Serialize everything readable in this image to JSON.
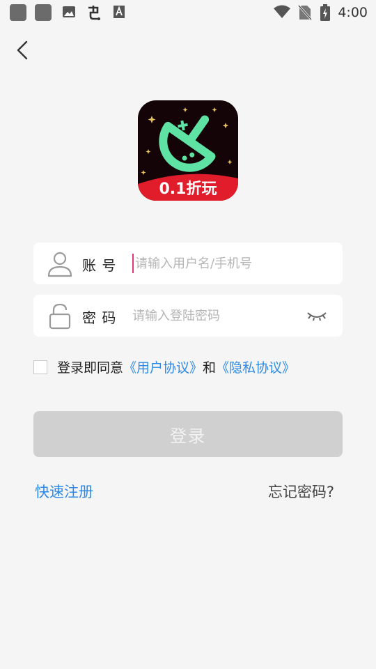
{
  "status_bar": {
    "time": "4:00",
    "icons": [
      "app-icon",
      "app-icon",
      "image-icon",
      "game-icon",
      "font-icon",
      "wifi-icon",
      "no-sim-icon",
      "battery-charging-icon"
    ]
  },
  "header": {
    "back_icon": "back-arrow-icon"
  },
  "logo": {
    "text": "0.1折玩"
  },
  "account": {
    "label": "账 号",
    "placeholder": "请输入用户名/手机号",
    "icon": "user-icon"
  },
  "password": {
    "label": "密 码",
    "placeholder": "请输入登陆密码",
    "icon": "lock-icon",
    "toggle_icon": "eye-closed-icon"
  },
  "agreement": {
    "checked": false,
    "prefix": "登录即同意",
    "user_link": "《用户协议》",
    "conjunction": "和",
    "privacy_link": "《隐私协议》"
  },
  "login": {
    "label": "登录"
  },
  "links": {
    "register": "快速注册",
    "forgot": "忘记密码?"
  },
  "colors": {
    "accent": "#2e8ae6",
    "caret": "#e0357a",
    "button_disabled": "#d0d0d0",
    "background": "#f5f5f5"
  }
}
